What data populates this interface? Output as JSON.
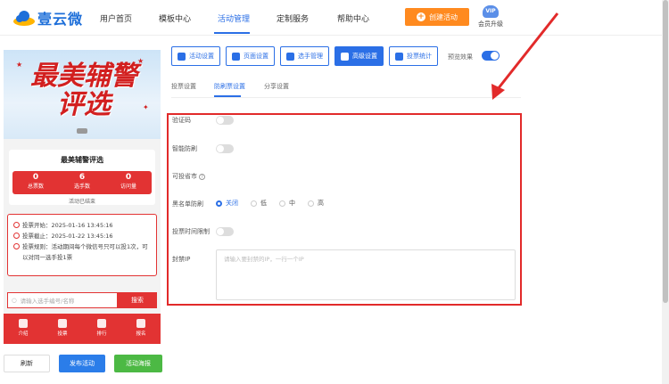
{
  "brand": {
    "name": "壹云微"
  },
  "nav": {
    "items": [
      {
        "label": "用户首页"
      },
      {
        "label": "模板中心"
      },
      {
        "label": "活动管理"
      },
      {
        "label": "定制服务"
      },
      {
        "label": "帮助中心"
      }
    ],
    "active_index": 2,
    "create_label": "创建活动",
    "vip_badge": "VIP",
    "vip_label": "会员升级"
  },
  "phone": {
    "banner_title": "最美辅警评选",
    "card_title": "最美辅警评选",
    "stats": [
      {
        "value": "0",
        "label": "总票数"
      },
      {
        "value": "6",
        "label": "选手数"
      },
      {
        "value": "0",
        "label": "访问量"
      }
    ],
    "status": "活动已结束",
    "info": [
      "投票开始：2025-01-16 13:45:16",
      "投票截止：2025-01-22 13:45:16",
      "投票规则：活动期间每个微信号只可以投1次，可以对同一选手投1票"
    ],
    "search_placeholder": "请输入选手编号/名称",
    "search_label": "搜索",
    "tabs": [
      {
        "label": "介绍"
      },
      {
        "label": "投票"
      },
      {
        "label": "排行"
      },
      {
        "label": "报名"
      }
    ]
  },
  "actions": {
    "refresh": "刷新",
    "publish": "发布活动",
    "poster": "活动海报"
  },
  "toolbar": {
    "buttons": [
      {
        "label": "活动设置",
        "icon": "gear-icon"
      },
      {
        "label": "页面设置",
        "icon": "page-icon"
      },
      {
        "label": "选手管理",
        "icon": "users-icon"
      },
      {
        "label": "高级设置",
        "icon": "advanced-icon"
      },
      {
        "label": "投票统计",
        "icon": "stats-icon"
      }
    ],
    "active_index": 3,
    "preview_label": "预览效果"
  },
  "subtabs": {
    "items": [
      {
        "label": "投票设置"
      },
      {
        "label": "防刷票设置"
      },
      {
        "label": "分享设置"
      }
    ],
    "active_index": 1
  },
  "form": {
    "captcha_label": "验证码",
    "smart_label": "智能防刷",
    "city_label": "可投省市",
    "blacklist_label": "黑名单防刷",
    "blacklist_options": [
      "关闭",
      "低",
      "中",
      "高"
    ],
    "blacklist_selected": "关闭",
    "time_limit_label": "投票时间限制",
    "ip_label": "封禁IP",
    "ip_placeholder": "请输入要封禁的IP，一行一个IP"
  },
  "colors": {
    "primary": "#2b6fe6",
    "accent_red": "#e23333",
    "orange": "#ff8a1f",
    "green": "#4cb944"
  }
}
